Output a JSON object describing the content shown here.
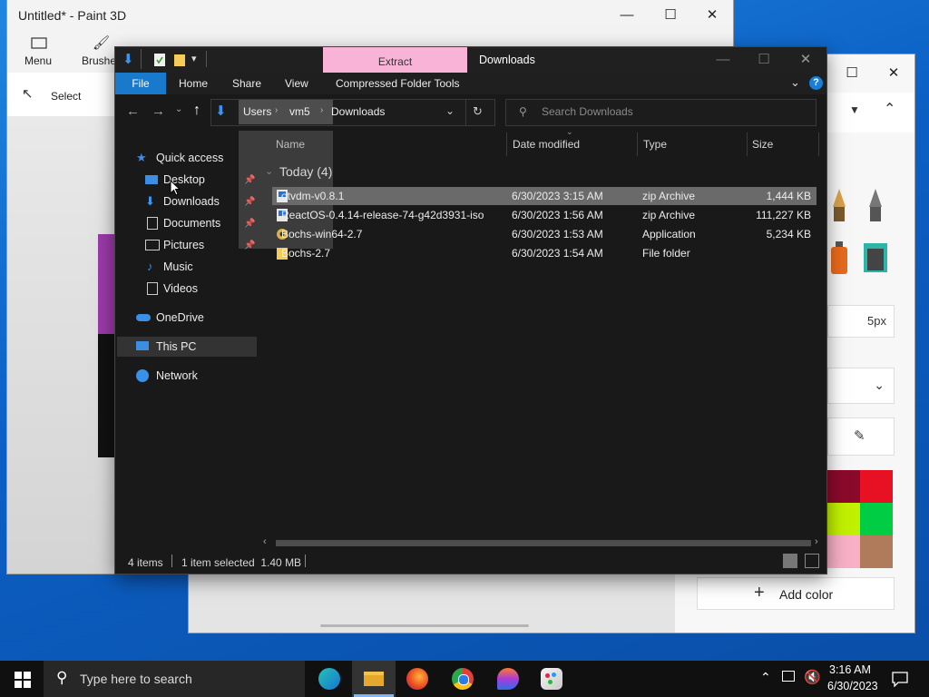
{
  "paint": {
    "title": "Untitled* - Paint 3D",
    "menu_label": "Menu",
    "brushes_label": "Brushes",
    "select_label": "Select",
    "size_value": "5px",
    "add_color_label": "Add color",
    "colors": [
      "#8b0a2b",
      "#e81123",
      "#c1f000",
      "#00cc44",
      "#f7b0c6",
      "#b07b5a"
    ]
  },
  "explorer": {
    "qat_arrow": "⬇",
    "extract_label": "Extract",
    "title": "Downloads",
    "tabs": [
      "File",
      "Home",
      "Share",
      "View",
      "Compressed Folder Tools"
    ],
    "breadcrumb": [
      "Users",
      "vm5",
      "Downloads"
    ],
    "search_placeholder": "Search Downloads",
    "nav": {
      "quick_access": "Quick access",
      "desktop": "Desktop",
      "downloads": "Downloads",
      "documents": "Documents",
      "pictures": "Pictures",
      "music": "Music",
      "videos": "Videos",
      "onedrive": "OneDrive",
      "this_pc": "This PC",
      "network": "Network"
    },
    "columns": {
      "name": "Name",
      "date": "Date modified",
      "type": "Type",
      "size": "Size"
    },
    "group_label": "Today (4)",
    "files": [
      {
        "name": "otvdm-v0.8.1",
        "date": "6/30/2023 3:15 AM",
        "type": "zip Archive",
        "size": "1,444 KB"
      },
      {
        "name": "ReactOS-0.4.14-release-74-g42d3931-iso",
        "date": "6/30/2023 1:56 AM",
        "type": "zip Archive",
        "size": "111,227 KB"
      },
      {
        "name": "Bochs-win64-2.7",
        "date": "6/30/2023 1:53 AM",
        "type": "Application",
        "size": "5,234 KB"
      },
      {
        "name": "Bochs-2.7",
        "date": "6/30/2023 1:54 AM",
        "type": "File folder",
        "size": ""
      }
    ],
    "status": {
      "items": "4 items",
      "selected": "1 item selected  1.40 MB"
    }
  },
  "taskbar": {
    "search_placeholder": "Type here to search",
    "time": "3:16 AM",
    "date": "6/30/2023"
  }
}
